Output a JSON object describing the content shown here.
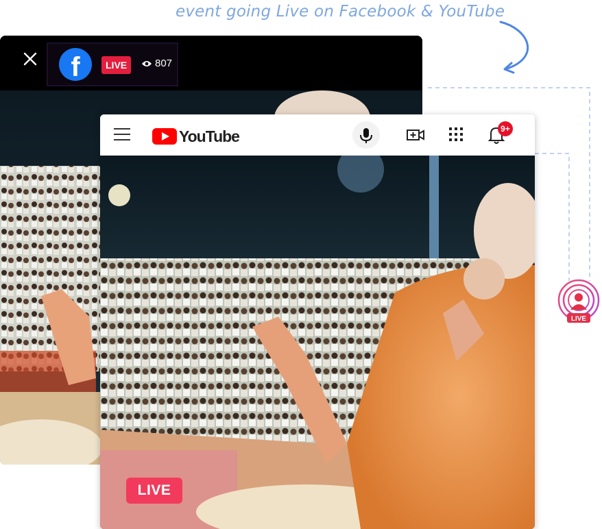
{
  "caption": "event going Live on Facebook & YouTube",
  "facebook": {
    "live_label": "LIVE",
    "viewer_count": "807",
    "icons": [
      "close-icon",
      "facebook-logo-icon",
      "eye-icon"
    ],
    "colors": {
      "brand": "#1877f2",
      "live": "#e41e3f"
    }
  },
  "youtube": {
    "wordmark": "YouTube",
    "notification_count": "9+",
    "live_label": "LIVE",
    "icons": [
      "menu-icon",
      "youtube-play-icon",
      "mic-icon",
      "create-video-icon",
      "apps-grid-icon",
      "bell-icon"
    ],
    "colors": {
      "brand": "#ff0000",
      "live": "#f23b5c"
    }
  },
  "live_icon_label": "LIVE"
}
